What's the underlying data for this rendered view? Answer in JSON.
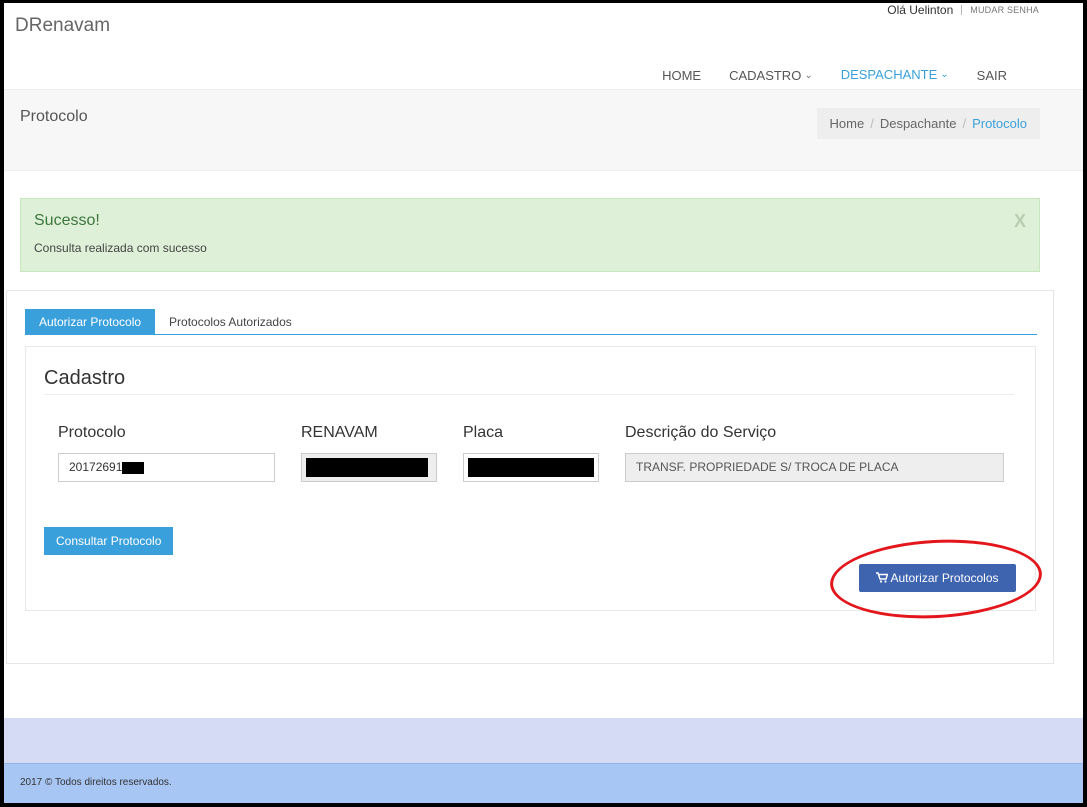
{
  "header": {
    "brand": "DRenavam",
    "greeting": "Olá Uelinton",
    "change_password": "MUDAR SENHA"
  },
  "nav": {
    "items": [
      {
        "label": "HOME"
      },
      {
        "label": "CADASTRO",
        "chev": "⌄"
      },
      {
        "label": "DESPACHANTE",
        "chev": "⌄"
      },
      {
        "label": "SAIR"
      }
    ]
  },
  "page": {
    "title": "Protocolo",
    "breadcrumb": [
      "Home",
      "Despachante",
      "Protocolo"
    ],
    "breadcrumb_sep": "/"
  },
  "alert": {
    "title": "Sucesso!",
    "message": "Consulta realizada com sucesso",
    "close": "X"
  },
  "tabs": [
    "Autorizar Protocolo",
    "Protocolos Autorizados"
  ],
  "form": {
    "section_title": "Cadastro",
    "protocolo_label": "Protocolo",
    "protocolo_value": "20172691",
    "renavam_label": "RENAVAM",
    "placa_label": "Placa",
    "descricao_label": "Descrição do Serviço",
    "descricao_value": "TRANSF. PROPRIEDADE S/ TROCA DE PLACA",
    "consult_button": "Consultar Protocolo",
    "authorize_button": "Autorizar Protocolos"
  },
  "icons": {
    "cart": "cart-icon"
  },
  "footer": {
    "copyright": "2017 © Todos direitos reservados."
  },
  "colors": {
    "accent": "#3aa0db",
    "success_bg": "#dff0d8",
    "authorize_button": "#3e64b0",
    "annotation": "#e3161c"
  }
}
